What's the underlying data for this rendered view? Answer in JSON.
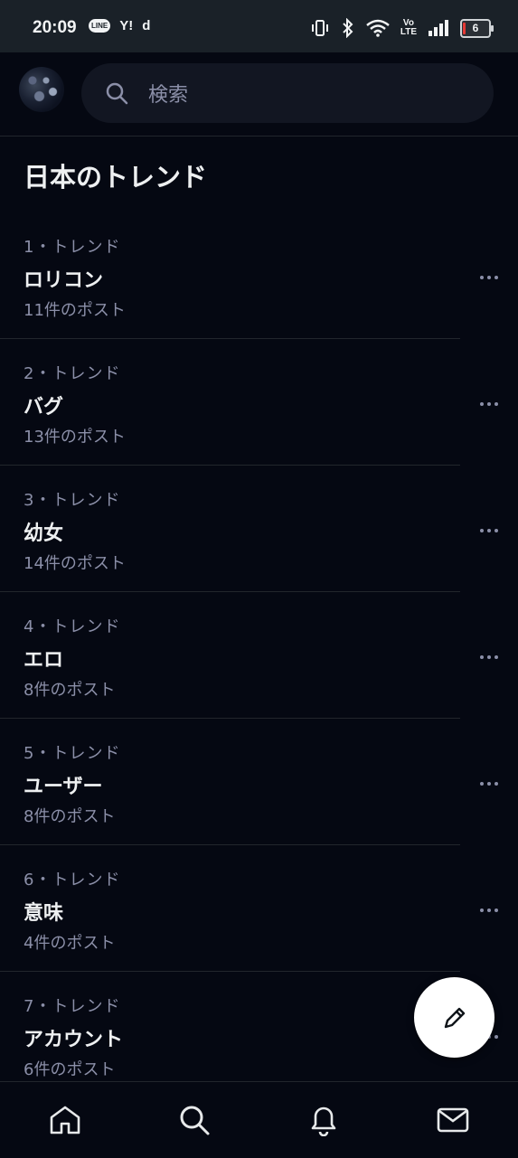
{
  "status_bar": {
    "time": "20:09",
    "notifications": [
      "LINE",
      "Y!",
      "d"
    ],
    "volte_top": "Vo",
    "volte_bottom": "LTE",
    "battery": "6"
  },
  "header": {
    "search_placeholder": "検索"
  },
  "section_title": "日本のトレンド",
  "trends": [
    {
      "meta": "1・トレンド",
      "name": "ロリコン",
      "count": "11件のポスト"
    },
    {
      "meta": "2・トレンド",
      "name": "バグ",
      "count": "13件のポスト"
    },
    {
      "meta": "3・トレンド",
      "name": "幼女",
      "count": "14件のポスト"
    },
    {
      "meta": "4・トレンド",
      "name": "エロ",
      "count": "8件のポスト"
    },
    {
      "meta": "5・トレンド",
      "name": "ユーザー",
      "count": "8件のポスト"
    },
    {
      "meta": "6・トレンド",
      "name": "意味",
      "count": "4件のポスト"
    },
    {
      "meta": "7・トレンド",
      "name": "アカウント",
      "count": "6件のポスト"
    }
  ],
  "fab": {
    "icon": "pencil-icon"
  },
  "bottom_nav": [
    {
      "icon": "home-icon"
    },
    {
      "icon": "search-icon"
    },
    {
      "icon": "bell-icon"
    },
    {
      "icon": "mail-icon"
    }
  ],
  "colors": {
    "background": "#050812",
    "secondary_text": "#8b8fa8",
    "divider": "#22262c",
    "status_bar": "#1a2128"
  }
}
